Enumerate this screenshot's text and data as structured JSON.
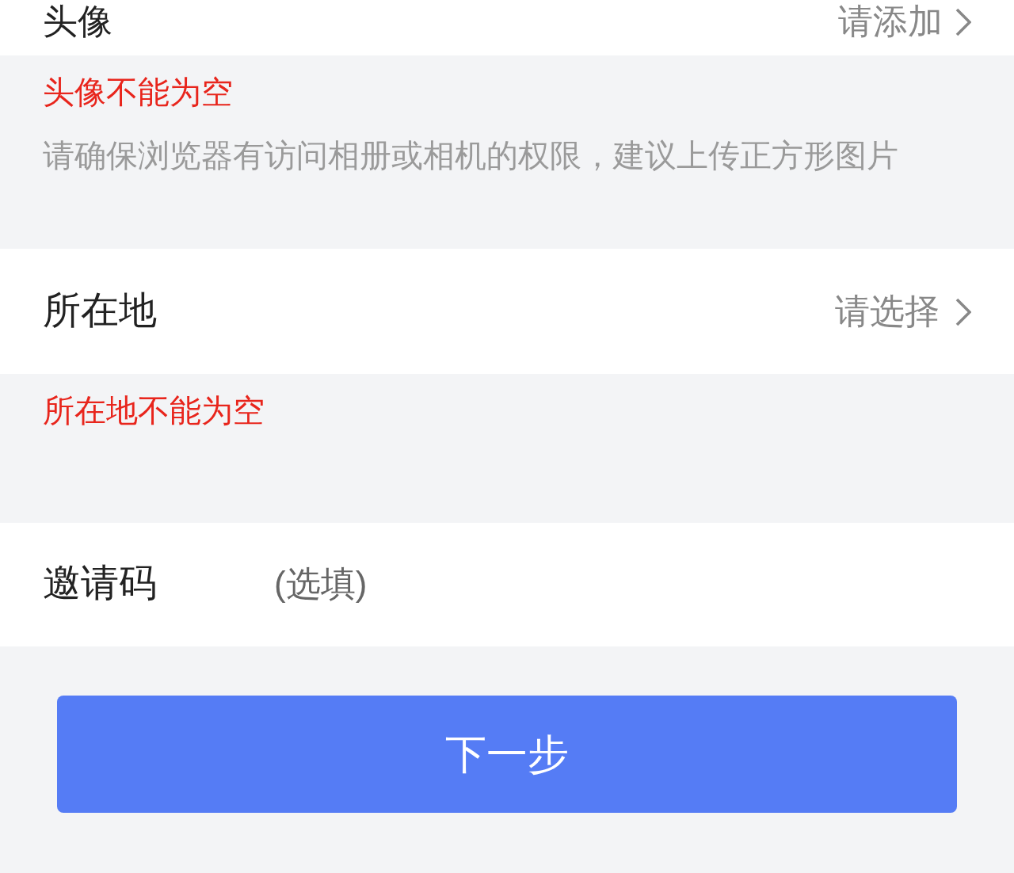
{
  "avatar": {
    "label": "头像",
    "action": "请添加",
    "error": "头像不能为空",
    "hint": "请确保浏览器有访问相册或相机的权限，建议上传正方形图片"
  },
  "location": {
    "label": "所在地",
    "action": "请选择",
    "error": "所在地不能为空"
  },
  "invite": {
    "label": "邀请码",
    "placeholder": "(选填)"
  },
  "next_button": "下一步"
}
